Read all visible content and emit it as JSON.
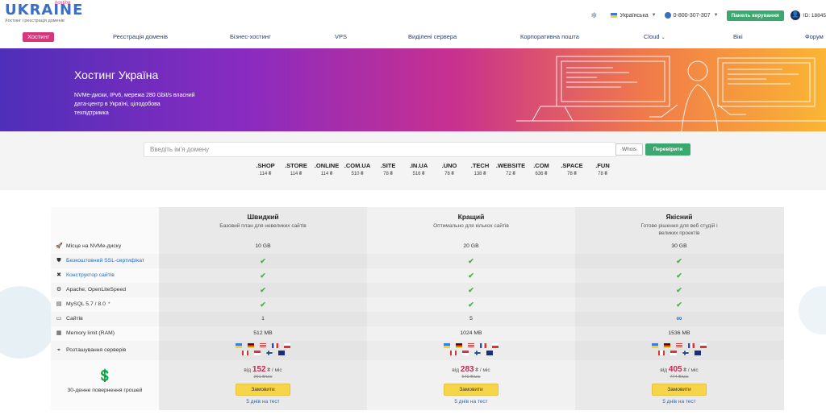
{
  "header": {
    "logo": {
      "main": "UKRAINE",
      "hosting": "hosting",
      "tagline": "Хостинг і реєстрація доменів"
    },
    "language": "Українська",
    "phone": "0-800-307-307",
    "panel_button": "Панель керування",
    "user_id": "ID: 18845"
  },
  "nav": [
    {
      "label": "Хостинг",
      "active": true
    },
    {
      "label": "Реєстрація доменів"
    },
    {
      "label": "Бізнес-хостинг"
    },
    {
      "label": "VPS"
    },
    {
      "label": "Виділені сервера"
    },
    {
      "label": "Корпоративна пошта"
    },
    {
      "label": "Cloud"
    },
    {
      "label": "Вікі"
    },
    {
      "label": "Форум"
    }
  ],
  "hero": {
    "title": "Хостинг Україна",
    "description": "NVMe-диски, IPv6, мережа 280 Gbit/s власний дата-центр в Україні, цілодобова техпідтримка"
  },
  "domain_search": {
    "placeholder": "Введіть ім'я домену",
    "whois_label": "Whois",
    "check_label": "Перевірити",
    "zones": [
      {
        "name": ".SHOP",
        "price": "114 ₴"
      },
      {
        "name": ".STORE",
        "price": "114 ₴"
      },
      {
        "name": ".ONLINE",
        "price": "114 ₴"
      },
      {
        "name": ".COM.UA",
        "price": "510 ₴"
      },
      {
        "name": ".SITE",
        "price": "78 ₴"
      },
      {
        "name": ".IN.UA",
        "price": "516 ₴"
      },
      {
        "name": ".UNO",
        "price": "78 ₴"
      },
      {
        "name": ".TECH",
        "price": "138 ₴"
      },
      {
        "name": ".WEBSITE",
        "price": "72 ₴"
      },
      {
        "name": ".COM",
        "price": "636 ₴"
      },
      {
        "name": ".SPACE",
        "price": "78 ₴"
      },
      {
        "name": ".FUN",
        "price": "78 ₴"
      }
    ]
  },
  "plans": [
    {
      "name": "Швидкий",
      "description": "Базовий план для невеликих сайтів",
      "disk": "10 GB",
      "sites": "1",
      "memory": "512 MB",
      "price": "152",
      "old_price": "291 ₴/міс"
    },
    {
      "name": "Кращий",
      "description": "Оптимально для кількох сайтів",
      "disk": "20 GB",
      "sites": "5",
      "memory": "1024 MB",
      "price": "283",
      "old_price": "540 ₴/міс"
    },
    {
      "name": "Якісний",
      "description": "Готове рішення для веб студій і великих проектів",
      "disk": "30 GB",
      "sites": "∞",
      "memory": "1536 MB",
      "price": "405",
      "old_price": "774 ₴/міс"
    }
  ],
  "features": {
    "disk": "Місце на NVMe-диску",
    "ssl": "Безкоштовний SSL-сертифікат",
    "builder": "Конструктор сайтів",
    "apache": "Apache, OpenLiteSpeed",
    "mysql": "MySQL 5.7 / 8.0",
    "mysql_mark": "*",
    "sites": "Сайтів",
    "memory": "Memory limit (RAM)",
    "location": "Розташування серверів"
  },
  "pricing": {
    "from": "від",
    "unit": "₴ / міс",
    "order_label": "Замовити",
    "trial_label": "5 днів на тест",
    "money_back": "30-денне повернення грошей"
  }
}
